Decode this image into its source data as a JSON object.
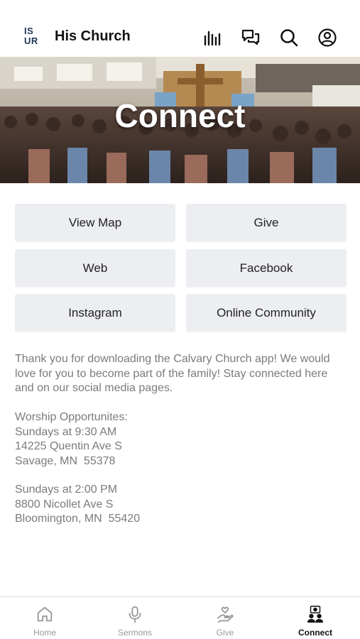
{
  "header": {
    "logo": {
      "line1": "IS",
      "line2": "UR"
    },
    "title": "His Church",
    "icons": [
      "activity-bars-icon",
      "chat-icon",
      "search-icon",
      "account-icon"
    ]
  },
  "banner": {
    "title": "Connect"
  },
  "buttons": [
    {
      "label": "View Map"
    },
    {
      "label": "Give"
    },
    {
      "label": "Web"
    },
    {
      "label": "Facebook"
    },
    {
      "label": "Instagram"
    },
    {
      "label": "Online Community"
    }
  ],
  "intro": "Thank you for downloading the Calvary Church app! We would love for you to become part of the family! Stay connected here and on our social media pages.",
  "worship": {
    "heading": "Worship Opportunites:",
    "first": [
      "Sundays at 9:30 AM",
      "14225 Quentin Ave S",
      "Savage, MN  55378"
    ],
    "second": [
      "Sundays at 2:00 PM",
      "8800 Nicollet Ave S",
      "Bloomington, MN  55420"
    ]
  },
  "tabs": [
    {
      "label": "Home",
      "icon": "home-icon",
      "active": false
    },
    {
      "label": "Sermons",
      "icon": "microphone-icon",
      "active": false
    },
    {
      "label": "Give",
      "icon": "give-hand-icon",
      "active": false
    },
    {
      "label": "Connect",
      "icon": "connect-people-icon",
      "active": true
    }
  ],
  "colors": {
    "logo_navy": "#1e3558",
    "logo_accent": "#f0b233",
    "button_bg": "#eceef1",
    "muted_text": "#7b7b7b"
  }
}
